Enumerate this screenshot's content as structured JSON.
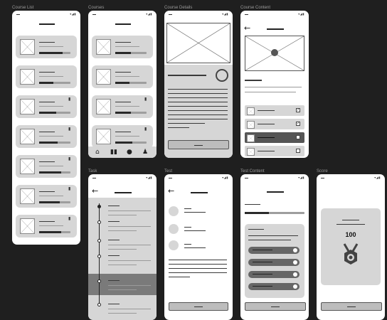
{
  "labels": {
    "course_list": "Course List",
    "courses": "Courses",
    "course_details": "Course Details",
    "course_content": "Course Content",
    "task": "Task",
    "test": "Test",
    "test_content": "Test Content",
    "score": "Score"
  },
  "status_icons": "▾◢▮",
  "back_arrow": "←",
  "score": {
    "value": "100",
    "icon": "medal-icon"
  },
  "icons": {
    "document": "document-icon",
    "home": "home-icon",
    "book": "book-icon",
    "chat": "chat-icon",
    "profile": "profile-icon",
    "play": "play-icon",
    "check": "✓"
  },
  "course_list_progress": [
    0.75,
    0.45,
    0.55,
    0.6,
    0.7,
    0.65,
    0.7
  ],
  "courses_progress": [
    0.5,
    0.45,
    0.5,
    0.55
  ],
  "test_content_progress": 0.4
}
